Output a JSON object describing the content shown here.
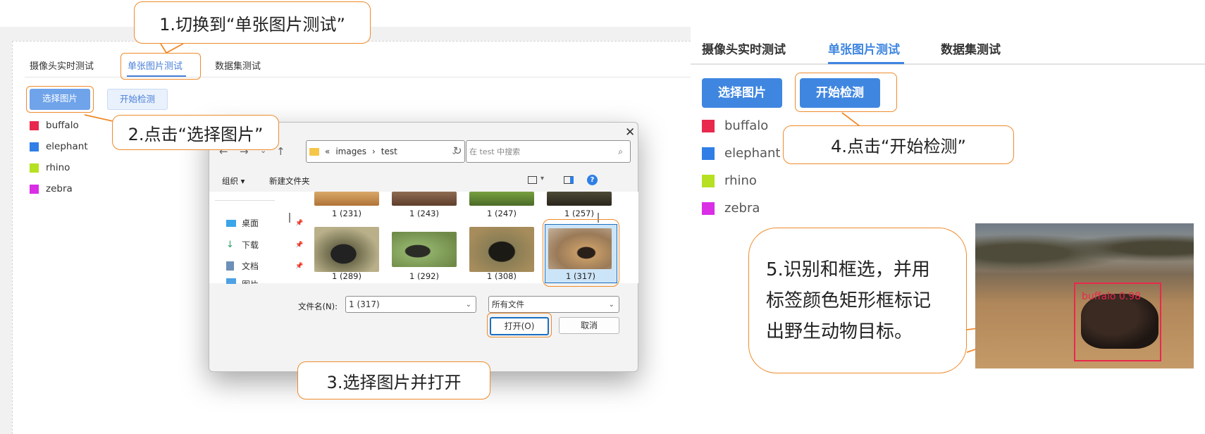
{
  "left_app": {
    "tabs": [
      "摄像头实时测试",
      "单张图片测试",
      "数据集测试"
    ],
    "active_tab": 1,
    "buttons": {
      "select": "选择图片",
      "detect": "开始检测"
    },
    "legend": [
      {
        "label": "buffalo",
        "color": "#e8294d"
      },
      {
        "label": "elephant",
        "color": "#2f7fe6"
      },
      {
        "label": "rhino",
        "color": "#b6e021"
      },
      {
        "label": "zebra",
        "color": "#d92ee6"
      }
    ]
  },
  "callouts": {
    "c1": "1.切换到“单张图片测试”",
    "c2": "2.点击“选择图片”",
    "c3": "3.选择图片并打开",
    "c4": "4.点击“开始检测”",
    "c5_lines": [
      "5.识别和框选，并用",
      "标签颜色矩形框标记",
      "出野生动物目标。"
    ]
  },
  "dialog": {
    "path": [
      "«",
      "images",
      "›",
      "test"
    ],
    "search_placeholder": "在 test 中搜索",
    "toolbar": {
      "organize": "组织 ▾",
      "new_folder": "新建文件夹"
    },
    "nav_items": [
      "桌面",
      "下载",
      "文档",
      "图片"
    ],
    "top_row_captions": [
      "1 (231)",
      "1 (243)",
      "1 (247)",
      "1 (257)"
    ],
    "files": [
      "1 (289)",
      "1 (292)",
      "1 (308)",
      "1 (317)"
    ],
    "selected_index": 3,
    "filename_label": "文件名(N):",
    "filename_value": "1 (317)",
    "filetype": "所有文件",
    "open_button": "打开(O)",
    "cancel_button": "取消"
  },
  "right_app": {
    "tabs": [
      "摄像头实时测试",
      "单张图片测试",
      "数据集测试"
    ],
    "active_tab": 1,
    "buttons": {
      "select": "选择图片",
      "detect": "开始检测"
    },
    "legend": [
      {
        "label": "buffalo",
        "color": "#e8294d"
      },
      {
        "label": "elephant",
        "color": "#2f7fe6"
      },
      {
        "label": "rhino",
        "color": "#b6e021"
      },
      {
        "label": "zebra",
        "color": "#d92ee6"
      }
    ],
    "detection": {
      "label": "buffalo 0.98",
      "box_color": "#e8294d"
    }
  }
}
